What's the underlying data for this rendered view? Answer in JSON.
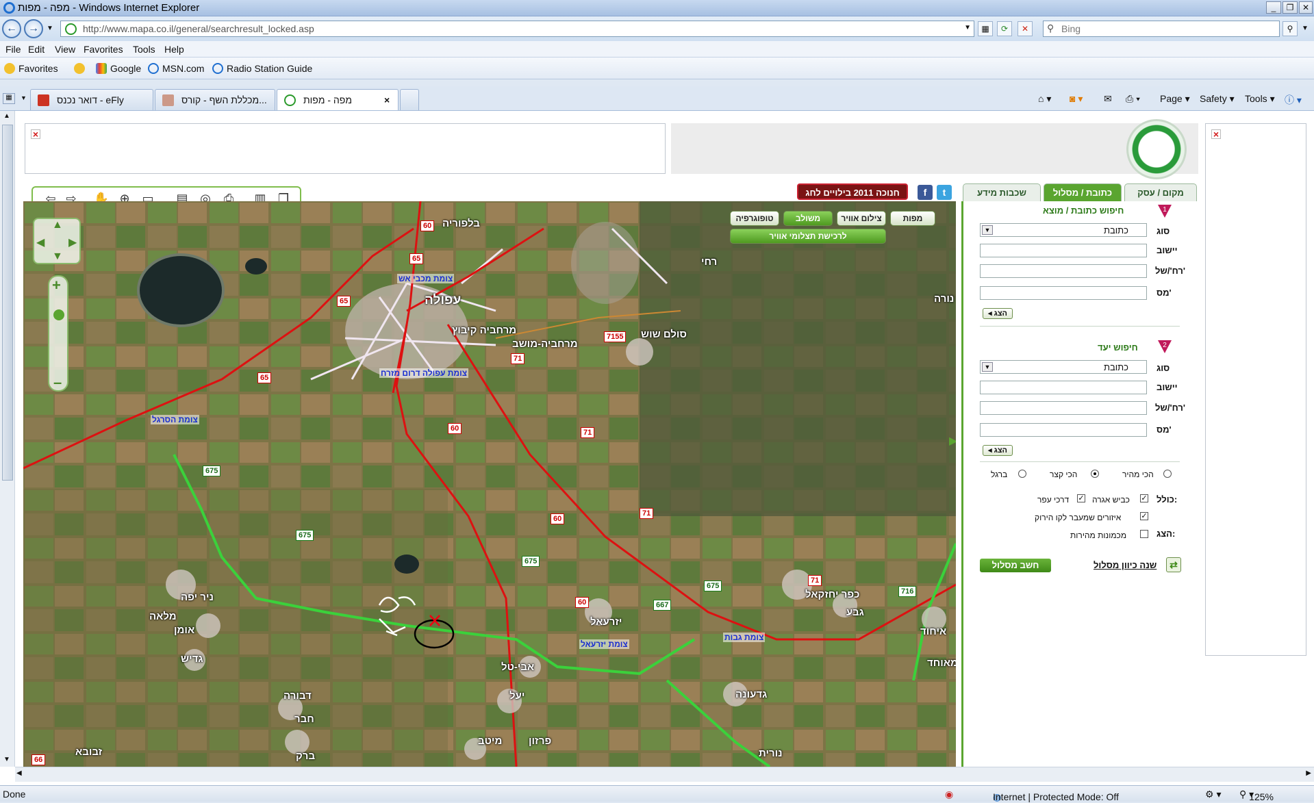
{
  "window": {
    "title": "מפה - מפות - Windows Internet Explorer"
  },
  "address": {
    "url": "http://www.mapa.co.il/general/searchresult_locked.asp",
    "search_placeholder": "Bing"
  },
  "menu": [
    "File",
    "Edit",
    "View",
    "Favorites",
    "Tools",
    "Help"
  ],
  "favorites": {
    "label": "Favorites",
    "items": [
      "Google",
      "MSN.com",
      "Radio Station Guide"
    ]
  },
  "tabs": [
    {
      "label": "דואר נכנס - eFly",
      "active": false
    },
    {
      "label": "מכללת השף - קורס...",
      "active": false
    },
    {
      "label": "מפה - מפות",
      "active": true
    }
  ],
  "commands": [
    "Page",
    "Safety",
    "Tools"
  ],
  "site": {
    "tabs": [
      "מקום / עסק",
      "כתובת / מסלול",
      "שכבות מידע"
    ],
    "hanukkah_banner": "חנוכה 2011 בילויים לחג",
    "map_view_buttons": [
      "מפות",
      "צילום אוויר",
      "משולב",
      "טופוגרפיה"
    ],
    "aerial_purchase": "לרכישת תצלומי אוויר"
  },
  "map": {
    "places": [
      "בלפוריה",
      "עפולה",
      "מרחביה קיבוץ",
      "מרחביה-מושב",
      "סולם שוש",
      "רחי",
      "נורה",
      "ניר יפה",
      "מלאה",
      "אומן",
      "גדיש",
      "יזרעאל",
      "כפר יחזקאל",
      "גבע",
      "איחוד",
      "אבי-טל",
      "יעל",
      "דבורה",
      "חבר",
      "מיטב",
      "פרזון",
      "גדעונה",
      "נורית",
      "ברק",
      "זבובא",
      "מאוחד"
    ],
    "junctions": [
      "צומת מכבי אש",
      "צומת עפולה דרום מזרח",
      "צומת הסרגל",
      "צומת יזרעאל",
      "צומת גבות"
    ],
    "road_numbers": [
      "60",
      "65",
      "65",
      "65",
      "71",
      "7155",
      "60",
      "71",
      "675",
      "675",
      "675",
      "60",
      "71",
      "60",
      "675",
      "667",
      "71",
      "716",
      "66"
    ],
    "handwritten": "ביתי"
  },
  "panel": {
    "origin_title": "חיפוש כתובת / מוצא",
    "dest_title": "חיפוש יעד",
    "type_label": "סוג",
    "type_value": "כתובת",
    "city_label": "יישוב",
    "street_label": "רח'/של'",
    "number_label": "מס'",
    "show_btn": "הצג",
    "route_options": [
      "הכי מהיר",
      "הכי קצר",
      "ברגל"
    ],
    "includes_label": "כולל:",
    "include_items": [
      "כביש אגרה",
      "דרכי עפר"
    ],
    "show_label": "הצג:",
    "show_items": [
      "איזורים שמעבר לקו הירוק",
      "מכמונות מהירות"
    ],
    "calc_route": "חשב מסלול",
    "change_direction": "שנה כיוון מסלול"
  },
  "status": {
    "left": "Done",
    "zone": "Internet | Protected Mode: Off",
    "zoom": "125%"
  }
}
